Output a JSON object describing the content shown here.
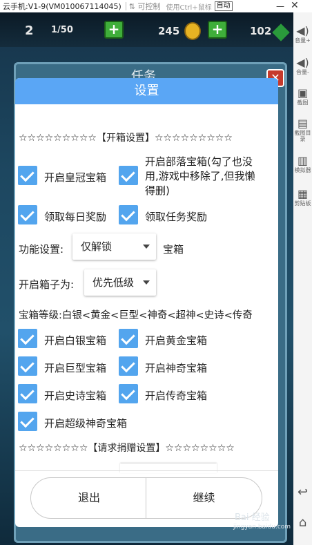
{
  "window": {
    "title": "云手机:V1-9(VM010067114045)",
    "control_mode": "可控制",
    "shortcut_hint": "使用Ctrl+鼠标",
    "auto_label": "自动",
    "minimize_symbol": "—",
    "close_symbol": "✕"
  },
  "game": {
    "level": "2",
    "capacity": "1/50",
    "coins": "245",
    "gems": "102",
    "panel_title": "任务",
    "plus": "+",
    "close": "✕"
  },
  "sidebar": {
    "items": [
      {
        "icon": "volume-up-icon",
        "glyph": "◀)",
        "label": "音量+"
      },
      {
        "icon": "volume-down-icon",
        "glyph": "◀)",
        "label": "音量-"
      },
      {
        "icon": "screenshot-icon",
        "glyph": "▣",
        "label": "截图"
      },
      {
        "icon": "screenshot-folder-icon",
        "glyph": "▤",
        "label": "截图目录"
      },
      {
        "icon": "clipboard-icon",
        "glyph": "▥",
        "label": "模拟器"
      },
      {
        "icon": "paste-icon",
        "glyph": "▦",
        "label": "剪贴板"
      }
    ],
    "back_glyph": "↩",
    "home_glyph": "⌂"
  },
  "dialog": {
    "title": "设置",
    "chest_section_header": "☆☆☆☆☆☆☆☆☆【开箱设置】☆☆☆☆☆☆☆☆☆",
    "checkboxes_top": [
      {
        "label": "开启皇冠宝箱",
        "checked": true
      },
      {
        "label": "开启部落宝箱(勾了也没用,游戏中移除了,但我懒得删)",
        "checked": true
      },
      {
        "label": "领取每日奖励",
        "checked": true
      },
      {
        "label": "领取任务奖励",
        "checked": true
      }
    ],
    "function_setting_label": "功能设置:",
    "function_setting_value": "仅解锁",
    "function_setting_suffix": "宝箱",
    "open_chest_label": "开启箱子为:",
    "open_chest_value": "优先低级",
    "chest_level_text": "宝箱等级:白银<黄金<巨型<神奇<超神<史诗<传奇",
    "checkboxes_levels": [
      {
        "label": "开启白银宝箱",
        "checked": true
      },
      {
        "label": "开启黄金宝箱",
        "checked": true
      },
      {
        "label": "开启巨型宝箱",
        "checked": true
      },
      {
        "label": "开启神奇宝箱",
        "checked": true
      },
      {
        "label": "开启史诗宝箱",
        "checked": true
      },
      {
        "label": "开启传奇宝箱",
        "checked": true
      },
      {
        "label": "开启超级神奇宝箱",
        "checked": true
      }
    ],
    "donation_section_header": "☆☆☆☆☆☆☆☆【请求捐赠设置】☆☆☆☆☆☆☆☆",
    "exit_button": "退出",
    "continue_button": "继续"
  },
  "watermark": {
    "text": "Bai 经验",
    "sub": "jingyan.baidu.com"
  },
  "colors": {
    "header_blue": "#5aa6f5",
    "checkbox_blue": "#53a5ee"
  }
}
